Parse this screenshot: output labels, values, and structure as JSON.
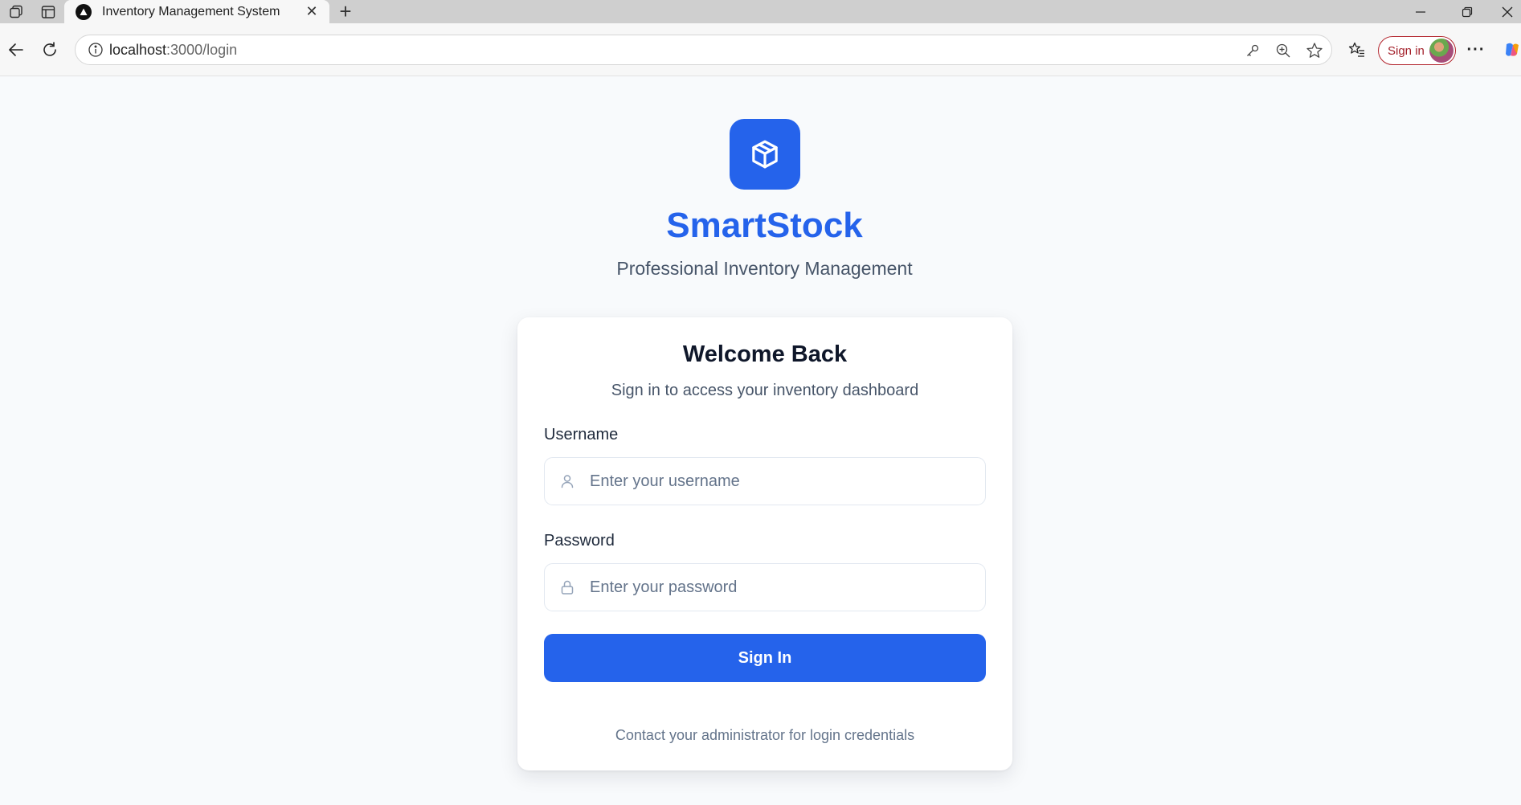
{
  "browser": {
    "tab_title": "Inventory Management System",
    "tab_close": "✕",
    "new_tab": "+",
    "url_host": "localhost",
    "url_rest": ":3000/login",
    "profile_signin_label": "Sign in",
    "more_label": "···"
  },
  "brand": {
    "name": "SmartStock",
    "tagline": "Professional Inventory Management",
    "accent_color": "#2563eb"
  },
  "login": {
    "title": "Welcome Back",
    "subtitle": "Sign in to access your inventory dashboard",
    "username_label": "Username",
    "username_placeholder": "Enter your username",
    "username_value": "",
    "password_label": "Password",
    "password_placeholder": "Enter your password",
    "password_value": "",
    "submit_label": "Sign In",
    "footnote": "Contact your administrator for login credentials"
  },
  "icons": {
    "logo": "package-icon",
    "username": "user-icon",
    "password": "lock-icon"
  }
}
